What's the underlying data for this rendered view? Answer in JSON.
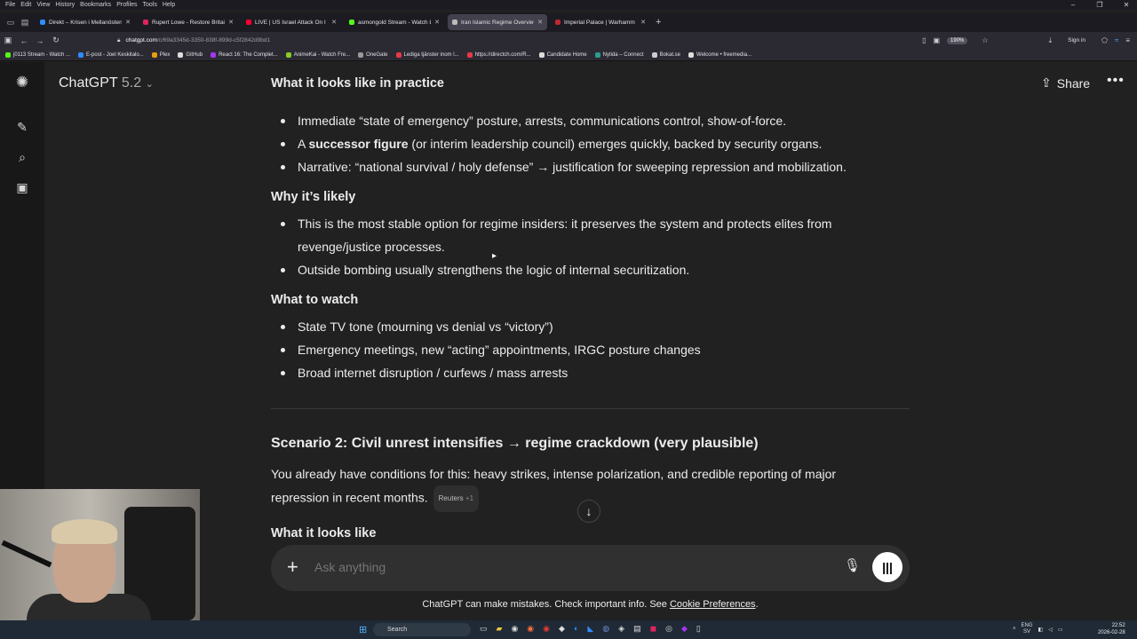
{
  "browser": {
    "menu": [
      "File",
      "Edit",
      "View",
      "History",
      "Bookmarks",
      "Profiles",
      "Tools",
      "Help"
    ],
    "tabs": [
      {
        "title": "Direkt – Krisen i Mellanöstern",
        "color": "#2d8cff"
      },
      {
        "title": "Rupert Lowe - Restore Britain",
        "color": "#e0245e"
      },
      {
        "title": "LIVE | US Israel Attack On I",
        "color": "#ff0033"
      },
      {
        "title": "asmongold Stream - Watch Liv",
        "color": "#53fc18"
      },
      {
        "title": "Iran Islamic Regime Overview",
        "color": "#bbbbbb"
      },
      {
        "title": "Imperial Palace | Warhamm",
        "color": "#c0262d"
      }
    ],
    "url_host": "chatgpt.com",
    "url_path": "/c/69a3345d-3350-838f-899d-c5f2842d9bd1",
    "zoom": "190%",
    "signin": "Sign in",
    "bookmarks": [
      {
        "label": "j0113 Stream - Watch ...",
        "color": "#53fc18"
      },
      {
        "label": "E-post - Joel Keskitalo...",
        "color": "#2d8cff"
      },
      {
        "label": "Plex",
        "color": "#e5a00d"
      },
      {
        "label": "GitHub",
        "color": "#dddddd"
      },
      {
        "label": "React 16: The Complet...",
        "color": "#a435f0"
      },
      {
        "label": "AnimeKai - Watch Fre...",
        "color": "#8ac926"
      },
      {
        "label": "OneGate",
        "color": "#999999"
      },
      {
        "label": "Lediga tjänster inom l...",
        "color": "#e63946"
      },
      {
        "label": "https://directch.com/R...",
        "color": "#e63946"
      },
      {
        "label": "Candidate Home",
        "color": "#dddddd"
      },
      {
        "label": "Nytida – Connect",
        "color": "#2a9d8f"
      },
      {
        "label": "Bokat.se",
        "color": "#cccccc"
      },
      {
        "label": "Welcome • freemedia...",
        "color": "#dddddd"
      }
    ]
  },
  "app": {
    "model_name": "ChatGPT",
    "model_version": "5.2",
    "share_label": "Share"
  },
  "conversation": {
    "h_practice": "What it looks like in practice",
    "practice_items": [
      "Immediate “state of emergency” posture, arrests, communications control, show-of-force.",
      "Narrative: “national survival / holy defense” → justification for sweeping repression and mobilization."
    ],
    "successor_prefix": "A ",
    "successor_bold": "successor figure",
    "successor_rest": " (or interim leadership council) emerges quickly, backed by security organs.",
    "h_likely": "Why it’s likely",
    "likely_1a": "This is the most stable option for regime insiders: it preserves the system and protects elites from",
    "likely_1b": "revenge/justice processes.",
    "likely_2": "Outside bombing usually strengthens the logic of internal securitization.",
    "h_watch": "What to watch",
    "watch_items": [
      "State TV tone (mourning vs denial vs “victory”)",
      "Emergency meetings, new “acting” appointments, IRGC posture changes",
      "Broad internet disruption / curfews / mass arrests"
    ],
    "h_scenario2": "Scenario 2: Civil unrest intensifies → regime crackdown (very plausible)",
    "scenario2_line1": "You already have conditions for this: heavy strikes, intense polarization, and credible reporting of major",
    "scenario2_line2": "repression in recent months.",
    "source_chip": "Reuters",
    "source_more": "+1",
    "h_looks_like": "What it looks like"
  },
  "composer": {
    "placeholder": "Ask anything"
  },
  "footer": {
    "disclaimer": "ChatGPT can make mistakes. Check important info. See",
    "link": "Cookie Preferences",
    "period": "."
  },
  "taskbar": {
    "search": "Search",
    "lang_1": "ENG",
    "lang_2": "SV",
    "time": "22:52",
    "date": "2026-02-28"
  }
}
